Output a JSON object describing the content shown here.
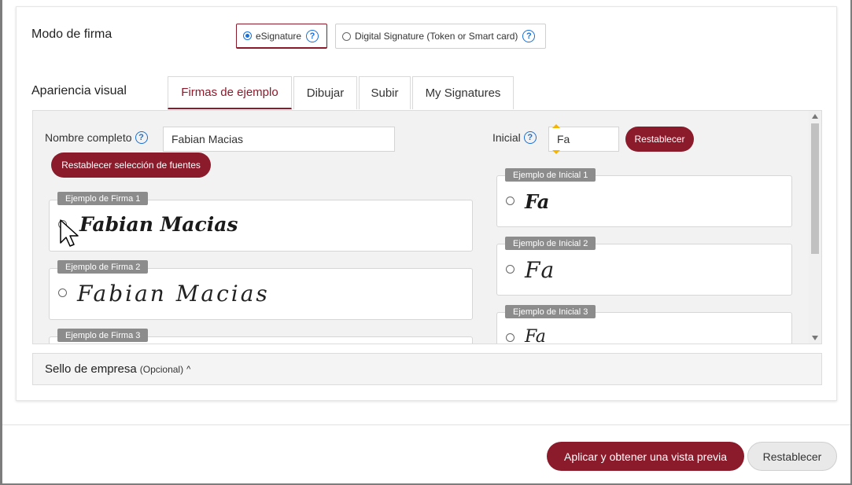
{
  "signing_mode": {
    "label": "Modo de firma",
    "options": [
      {
        "label": "eSignature",
        "selected": true
      },
      {
        "label": "Digital Signature (Token or Smart card)",
        "selected": false
      }
    ],
    "help_glyph": "?"
  },
  "visual_appearance": {
    "label": "Apariencia visual",
    "tabs": [
      {
        "label": "Firmas de ejemplo",
        "active": true
      },
      {
        "label": "Dibujar",
        "active": false
      },
      {
        "label": "Subir",
        "active": false
      },
      {
        "label": "My Signatures",
        "active": false
      }
    ]
  },
  "full_name": {
    "label": "Nombre completo",
    "value": "Fabian Macias"
  },
  "initial": {
    "label": "Inicial",
    "value": "Fa",
    "reset_label": "Restablecer"
  },
  "reset_fonts_label": "Restablecer selección de fuentes",
  "signature_samples": [
    {
      "tag": "Ejemplo de Firma 1",
      "text": "Fabian Macias"
    },
    {
      "tag": "Ejemplo de Firma 2",
      "text": "Fabian Macias"
    },
    {
      "tag": "Ejemplo de Firma 3",
      "text": ""
    }
  ],
  "initial_samples": [
    {
      "tag": "Ejemplo de Inicial 1",
      "text": "Fa"
    },
    {
      "tag": "Ejemplo de Inicial 2",
      "text": "Fa"
    },
    {
      "tag": "Ejemplo de Inicial 3",
      "text": "Fa"
    }
  ],
  "company_stamp": {
    "label": "Sello de empresa",
    "optional": "(Opcional)",
    "chevron": "^"
  },
  "footer": {
    "apply_label": "Aplicar y obtener una vista previa",
    "reset_label": "Restablecer"
  },
  "colors": {
    "accent": "#8b1a2b",
    "radio_blue": "#1a6fd6",
    "tag_gray": "#8c8c8c"
  }
}
